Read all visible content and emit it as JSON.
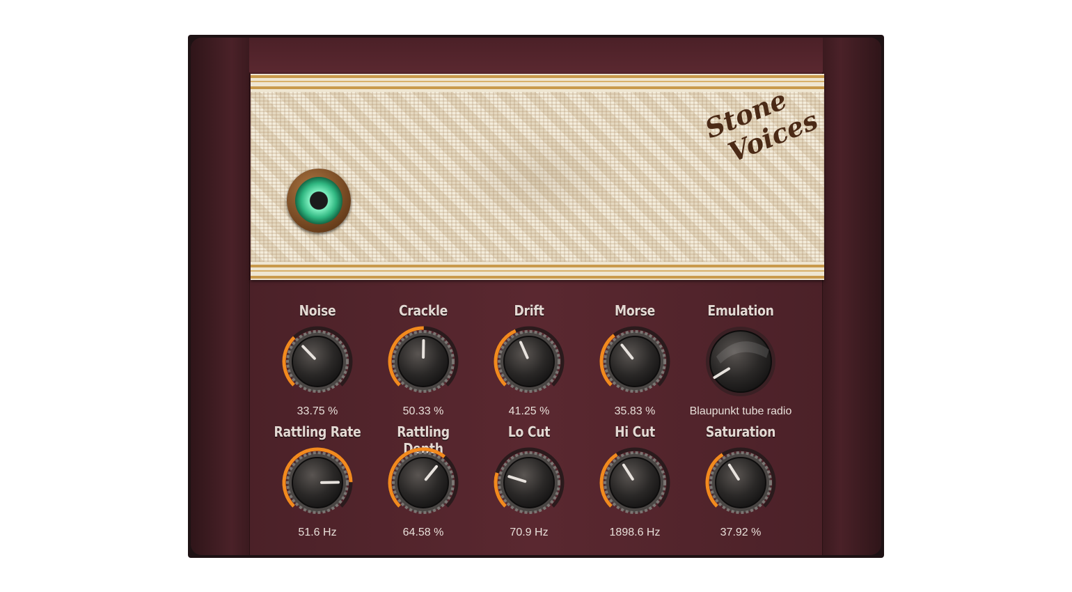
{
  "plugin": {
    "logo_line1": "Stone",
    "logo_line2": "Voices",
    "power": "on"
  },
  "colors": {
    "accent_arc": "#f28a1e",
    "cabinet": "#5a2830",
    "grille": "#efe5cf",
    "power_glow": "#2fb680",
    "label": "#e4d9d3"
  },
  "knobs": [
    {
      "label": "Noise",
      "value": "33.75 %",
      "level": 0.3375
    },
    {
      "label": "Crackle",
      "value": "50.33 %",
      "level": 0.5033
    },
    {
      "label": "Drift",
      "value": "41.25 %",
      "level": 0.4125
    },
    {
      "label": "Morse",
      "value": "35.83 %",
      "level": 0.3583
    },
    {
      "label": "Emulation",
      "value": "Blaupunkt tube radio",
      "level": 0.05,
      "style": "selector"
    },
    {
      "label": "Rattling Rate",
      "value": "51.6 Hz",
      "level": 0.83
    },
    {
      "label": "Rattling Depth",
      "value": "64.58 %",
      "level": 0.6458
    },
    {
      "label": "Lo Cut",
      "value": "70.9 Hz",
      "level": 0.23
    },
    {
      "label": "Hi Cut",
      "value": "1898.6 Hz",
      "level": 0.38
    },
    {
      "label": "Saturation",
      "value": "37.92 %",
      "level": 0.3792
    }
  ]
}
